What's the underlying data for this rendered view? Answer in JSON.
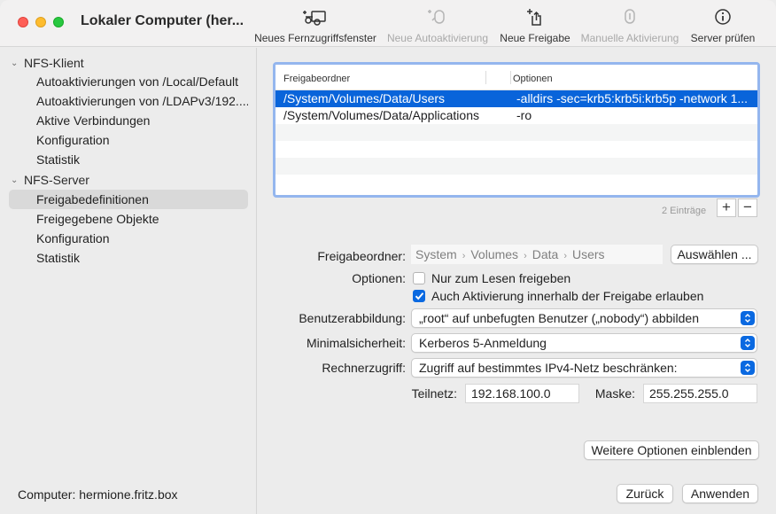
{
  "window": {
    "title": "Lokaler Computer (her..."
  },
  "toolbar": [
    {
      "label": "Neues Fernzugriffsfenster",
      "icon": "remote-window-icon",
      "enabled": true
    },
    {
      "label": "Neue Autoaktivierung",
      "icon": "auto-mount-icon",
      "enabled": false
    },
    {
      "label": "Neue Freigabe",
      "icon": "new-share-icon",
      "enabled": true
    },
    {
      "label": "Manuelle Aktivierung",
      "icon": "manual-mount-icon",
      "enabled": false
    },
    {
      "label": "Server prüfen",
      "icon": "info-icon",
      "enabled": true
    }
  ],
  "sidebar": {
    "client": {
      "label": "NFS-Klient",
      "items": [
        "Autoaktivierungen von /Local/Default",
        "Autoaktivierungen von /LDAPv3/192....",
        "Aktive Verbindungen",
        "Konfiguration",
        "Statistik"
      ]
    },
    "server": {
      "label": "NFS-Server",
      "items": [
        "Freigabedefinitionen",
        "Freigegebene Objekte",
        "Konfiguration",
        "Statistik"
      ],
      "selected_index": 0
    },
    "computer_label": "Computer: hermione.fritz.box"
  },
  "table": {
    "columns": [
      "Freigabeordner",
      "Optionen"
    ],
    "rows": [
      {
        "folder": "/System/Volumes/Data/Users",
        "options": "-alldirs -sec=krb5:krb5i:krb5p -network 1..."
      },
      {
        "folder": "/System/Volumes/Data/Applications",
        "options": "-ro"
      }
    ],
    "count_label": "2 Einträge",
    "add_label": "+",
    "remove_label": "−"
  },
  "form": {
    "folder_label": "Freigabeordner:",
    "folder_path": [
      "System",
      "Volumes",
      "Data",
      "Users"
    ],
    "choose_button": "Auswählen ...",
    "options_label": "Optionen:",
    "readonly_checkbox": {
      "label": "Nur zum Lesen freigeben",
      "checked": false
    },
    "alldirs_checkbox": {
      "label": "Auch Aktivierung innerhalb der Freigabe erlauben",
      "checked": true
    },
    "user_mapping_label": "Benutzerabbildung:",
    "user_mapping_value": "„root“ auf unbefugten Benutzer („nobody“) abbilden",
    "security_label": "Minimalsicherheit:",
    "security_value": "Kerberos 5-Anmeldung",
    "host_access_label": "Rechnerzugriff:",
    "host_access_value": "Zugriff auf bestimmtes IPv4-Netz beschränken:",
    "subnet_label": "Teilnetz:",
    "subnet_value": "192.168.100.0",
    "mask_label": "Maske:",
    "mask_value": "255.255.255.0",
    "more_options_button": "Weitere Optionen einblenden"
  },
  "footer": {
    "back_button": "Zurück",
    "apply_button": "Anwenden"
  },
  "colors": {
    "accent": "#0964da",
    "table_focus": "#94b6ee"
  }
}
